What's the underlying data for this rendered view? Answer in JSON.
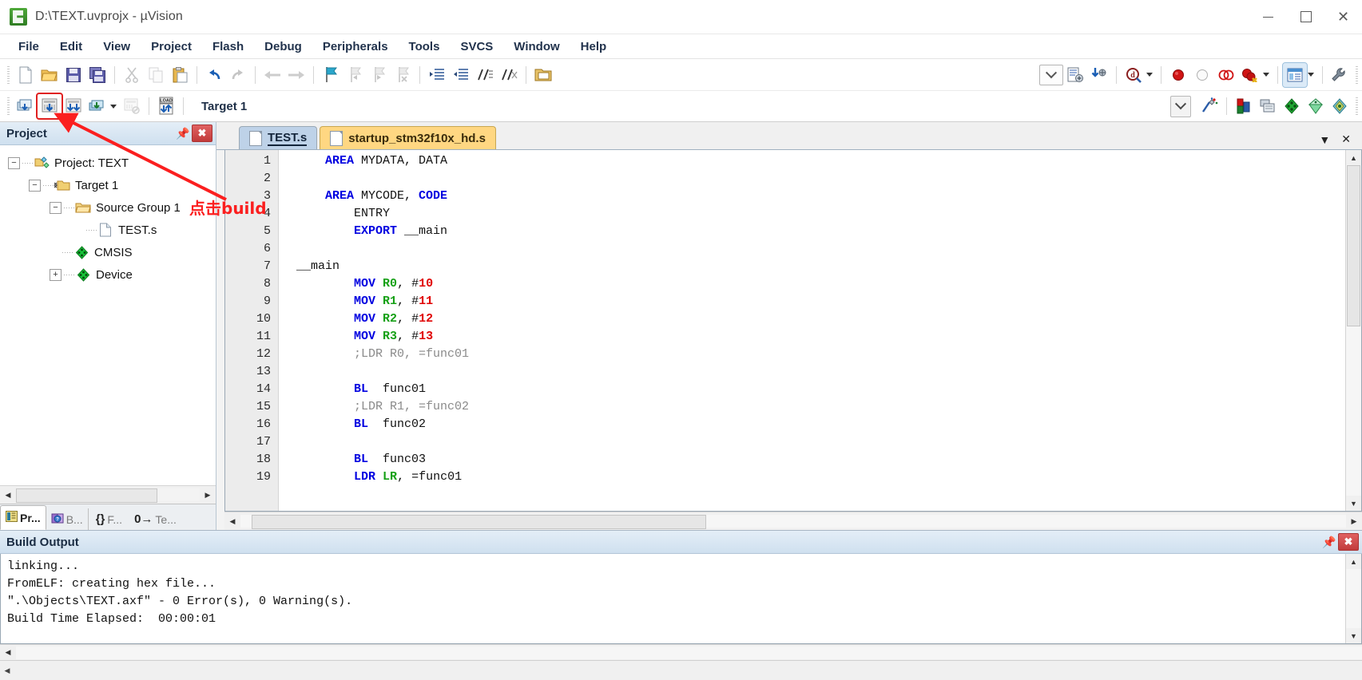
{
  "window": {
    "title": "D:\\TEXT.uvprojx - µVision",
    "app_icon": "uvision-logo-icon",
    "controls": {
      "minimize": "—",
      "maximize": "□",
      "close": "✕"
    }
  },
  "menu": {
    "items": [
      {
        "label": "File"
      },
      {
        "label": "Edit"
      },
      {
        "label": "View"
      },
      {
        "label": "Project"
      },
      {
        "label": "Flash"
      },
      {
        "label": "Debug"
      },
      {
        "label": "Peripherals"
      },
      {
        "label": "Tools"
      },
      {
        "label": "SVCS"
      },
      {
        "label": "Window"
      },
      {
        "label": "Help"
      }
    ]
  },
  "toolbar_main": {
    "buttons": [
      {
        "name": "new-file-icon"
      },
      {
        "name": "open-file-icon"
      },
      {
        "name": "save-icon"
      },
      {
        "name": "save-all-icon"
      },
      {
        "name": "cut-icon"
      },
      {
        "name": "copy-icon"
      },
      {
        "name": "paste-icon"
      },
      {
        "name": "undo-icon"
      },
      {
        "name": "redo-icon"
      },
      {
        "name": "navigate-back-icon"
      },
      {
        "name": "navigate-forward-icon"
      },
      {
        "name": "bookmark-toggle-icon"
      },
      {
        "name": "bookmark-prev-icon"
      },
      {
        "name": "bookmark-next-icon"
      },
      {
        "name": "bookmark-clear-icon"
      },
      {
        "name": "indent-right-icon"
      },
      {
        "name": "indent-left-icon"
      },
      {
        "name": "comment-lines-icon"
      },
      {
        "name": "uncomment-lines-icon"
      },
      {
        "name": "open-folder-window-icon"
      }
    ],
    "right_buttons": [
      {
        "name": "dropdown-combo-icon"
      },
      {
        "name": "configure-target-icon"
      },
      {
        "name": "insert-download-icon"
      },
      {
        "name": "find-in-files-icon"
      },
      {
        "name": "breakpoint-insert-icon"
      },
      {
        "name": "breakpoint-disable-icon"
      },
      {
        "name": "breakpoint-disable-all-icon"
      },
      {
        "name": "breakpoint-kill-all-icon"
      },
      {
        "name": "window-manage-icon"
      },
      {
        "name": "configure-tools-icon"
      }
    ]
  },
  "toolbar_build": {
    "buttons": [
      {
        "name": "translate-file-icon",
        "label": "Translate"
      },
      {
        "name": "build-target-icon",
        "label": "Build",
        "highlighted": true
      },
      {
        "name": "rebuild-all-icon",
        "label": "Rebuild"
      },
      {
        "name": "batch-build-icon",
        "label": "Batch Build"
      },
      {
        "name": "stop-build-icon",
        "label": "Stop Build"
      },
      {
        "name": "download-icon",
        "label": "Download"
      }
    ],
    "target_selector": {
      "value": "Target 1"
    },
    "right_buttons": [
      {
        "name": "target-options-icon"
      },
      {
        "name": "manage-components-icon"
      },
      {
        "name": "multi-project-icon"
      },
      {
        "name": "pack-installer-icon"
      },
      {
        "name": "manage-runtime-env-icon"
      },
      {
        "name": "software-packs-icon"
      }
    ]
  },
  "project_panel": {
    "title": "Project",
    "pin_icon": "pin-icon",
    "close_icon": "close-icon",
    "tree": [
      {
        "label": "Project: TEXT",
        "icon": "project-icon",
        "depth": 0,
        "expander": "−"
      },
      {
        "label": "Target 1",
        "icon": "target-folder-icon",
        "depth": 1,
        "expander": "−"
      },
      {
        "label": "Source Group 1",
        "icon": "folder-icon",
        "depth": 2,
        "expander": "−"
      },
      {
        "label": "TEST.s",
        "icon": "source-file-icon",
        "depth": 3,
        "expander": ""
      },
      {
        "label": "CMSIS",
        "icon": "component-icon",
        "depth": 2,
        "expander": ""
      },
      {
        "label": "Device",
        "icon": "component-icon",
        "depth": 2,
        "expander": "+"
      }
    ],
    "bottom_tabs": [
      {
        "label": "Pr...",
        "icon": "project-tab-icon",
        "active": true
      },
      {
        "label": "B...",
        "icon": "books-tab-icon",
        "active": false
      },
      {
        "label": "F...",
        "icon": "functions-tab-icon",
        "active": false
      },
      {
        "label": "Te...",
        "icon": "templates-tab-icon",
        "active": false
      }
    ]
  },
  "editor": {
    "tabs": [
      {
        "label": "TEST.s",
        "active": true,
        "icon": "source-file-icon"
      },
      {
        "label": "startup_stm32f10x_hd.s",
        "active": false,
        "icon": "source-file-icon"
      }
    ],
    "tab_controls": {
      "dropdown_icon": "chevron-down-icon",
      "close_icon": "close-icon"
    },
    "line_numbers": [
      "1",
      "2",
      "3",
      "4",
      "5",
      "6",
      "7",
      "8",
      "9",
      "10",
      "11",
      "12",
      "13",
      "14",
      "15",
      "16",
      "17",
      "18",
      "19"
    ],
    "lines": [
      {
        "n": "1",
        "tokens": [
          {
            "t": "    ",
            "c": "p"
          },
          {
            "t": "AREA",
            "c": "k"
          },
          {
            "t": " MYDATA, DATA",
            "c": "p"
          }
        ]
      },
      {
        "n": "2",
        "tokens": [
          {
            "t": "",
            "c": "p"
          }
        ]
      },
      {
        "n": "3",
        "tokens": [
          {
            "t": "    ",
            "c": "p"
          },
          {
            "t": "AREA",
            "c": "k"
          },
          {
            "t": " MYCODE, ",
            "c": "p"
          },
          {
            "t": "CODE",
            "c": "k"
          }
        ]
      },
      {
        "n": "4",
        "tokens": [
          {
            "t": "        ENTRY",
            "c": "p"
          }
        ]
      },
      {
        "n": "5",
        "tokens": [
          {
            "t": "        ",
            "c": "p"
          },
          {
            "t": "EXPORT",
            "c": "k"
          },
          {
            "t": " __main",
            "c": "p"
          }
        ]
      },
      {
        "n": "6",
        "tokens": [
          {
            "t": "",
            "c": "p"
          }
        ]
      },
      {
        "n": "7",
        "tokens": [
          {
            "t": "__main",
            "c": "p"
          }
        ]
      },
      {
        "n": "8",
        "tokens": [
          {
            "t": "        ",
            "c": "p"
          },
          {
            "t": "MOV",
            "c": "k"
          },
          {
            "t": " ",
            "c": "p"
          },
          {
            "t": "R0",
            "c": "reg"
          },
          {
            "t": ", #",
            "c": "p"
          },
          {
            "t": "10",
            "c": "num"
          }
        ]
      },
      {
        "n": "9",
        "tokens": [
          {
            "t": "        ",
            "c": "p"
          },
          {
            "t": "MOV",
            "c": "k"
          },
          {
            "t": " ",
            "c": "p"
          },
          {
            "t": "R1",
            "c": "reg"
          },
          {
            "t": ", #",
            "c": "p"
          },
          {
            "t": "11",
            "c": "num"
          }
        ]
      },
      {
        "n": "10",
        "tokens": [
          {
            "t": "        ",
            "c": "p"
          },
          {
            "t": "MOV",
            "c": "k"
          },
          {
            "t": " ",
            "c": "p"
          },
          {
            "t": "R2",
            "c": "reg"
          },
          {
            "t": ", #",
            "c": "p"
          },
          {
            "t": "12",
            "c": "num"
          }
        ]
      },
      {
        "n": "11",
        "tokens": [
          {
            "t": "        ",
            "c": "p"
          },
          {
            "t": "MOV",
            "c": "k"
          },
          {
            "t": " ",
            "c": "p"
          },
          {
            "t": "R3",
            "c": "reg"
          },
          {
            "t": ", #",
            "c": "p"
          },
          {
            "t": "13",
            "c": "num"
          }
        ]
      },
      {
        "n": "12",
        "tokens": [
          {
            "t": "        ",
            "c": "p"
          },
          {
            "t": ";LDR R0, =func01",
            "c": "cmt"
          }
        ]
      },
      {
        "n": "13",
        "tokens": [
          {
            "t": "",
            "c": "p"
          }
        ]
      },
      {
        "n": "14",
        "tokens": [
          {
            "t": "        ",
            "c": "p"
          },
          {
            "t": "BL",
            "c": "k"
          },
          {
            "t": "  func01",
            "c": "p"
          }
        ]
      },
      {
        "n": "15",
        "tokens": [
          {
            "t": "        ",
            "c": "p"
          },
          {
            "t": ";LDR R1, =func02",
            "c": "cmt"
          }
        ]
      },
      {
        "n": "16",
        "tokens": [
          {
            "t": "        ",
            "c": "p"
          },
          {
            "t": "BL",
            "c": "k"
          },
          {
            "t": "  func02",
            "c": "p"
          }
        ]
      },
      {
        "n": "17",
        "tokens": [
          {
            "t": "",
            "c": "p"
          }
        ]
      },
      {
        "n": "18",
        "tokens": [
          {
            "t": "        ",
            "c": "p"
          },
          {
            "t": "BL",
            "c": "k"
          },
          {
            "t": "  func03",
            "c": "p"
          }
        ]
      },
      {
        "n": "19",
        "tokens": [
          {
            "t": "        ",
            "c": "p"
          },
          {
            "t": "LDR",
            "c": "k"
          },
          {
            "t": " ",
            "c": "p"
          },
          {
            "t": "LR",
            "c": "reg"
          },
          {
            "t": ", =func01",
            "c": "p"
          }
        ]
      }
    ]
  },
  "build_output": {
    "title": "Build Output",
    "pin_icon": "pin-icon",
    "close_icon": "close-icon",
    "lines": [
      "linking...",
      "FromELF: creating hex file...",
      "\".\\Objects\\TEXT.axf\" - 0 Error(s), 0 Warning(s).",
      "Build Time Elapsed:  00:00:01"
    ]
  },
  "annotation": {
    "text": "点击build",
    "color": "#fb1f1f",
    "arrow_name": "red-arrow-annotation"
  },
  "colors": {
    "accent_blue": "#0000e0",
    "register_green": "#15a015",
    "number_red": "#e00000",
    "comment_gray": "#8a8a8a",
    "annotation_red": "#fb1f1f",
    "tab_active": "#bed2e8",
    "tab_inactive": "#ffd782"
  }
}
